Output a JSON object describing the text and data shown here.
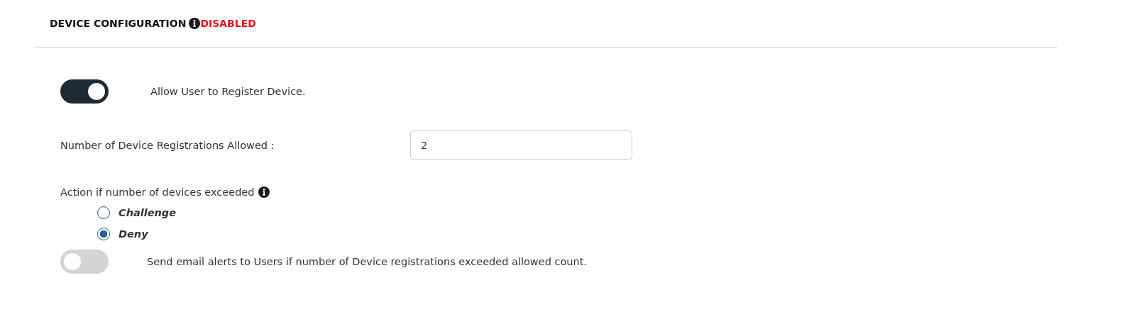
{
  "section": {
    "title": "DEVICE CONFIGURATION",
    "status": "DISABLED"
  },
  "register_toggle": {
    "on": true,
    "label": "Allow User to Register Device."
  },
  "registrations_field": {
    "label": "Number of Device Registrations Allowed :",
    "value": "2"
  },
  "exceed_action": {
    "label": "Action if number of devices exceeded",
    "options": [
      {
        "label": "Challenge",
        "selected": false
      },
      {
        "label": "Deny",
        "selected": true
      }
    ]
  },
  "email_toggle": {
    "on": false,
    "label": "Send email alerts to Users if number of Device registrations exceeded allowed count."
  }
}
